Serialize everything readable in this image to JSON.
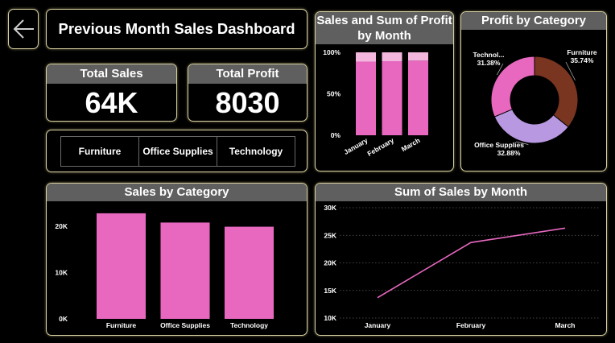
{
  "header": {
    "title": "Previous Month Sales Dashboard"
  },
  "kpis": {
    "total_sales_label": "Total Sales",
    "total_sales_value": "64K",
    "total_profit_label": "Total Profit",
    "total_profit_value": "8030"
  },
  "slicer": {
    "items": [
      "Furniture",
      "Office Supplies",
      "Technology"
    ]
  },
  "colors": {
    "accent_pink": "#e868c0",
    "light_pink": "#f3b6dc",
    "furniture_brown": "#7a3520",
    "office_lavender": "#b898e0",
    "header_gray": "#5f5f5f",
    "border_gold": "#d8d0a0"
  },
  "chart_data": [
    {
      "id": "stacked",
      "type": "bar",
      "stacked_percent": true,
      "title": "Sales and Sum of Profit by Month",
      "categories": [
        "January",
        "February",
        "March"
      ],
      "series": [
        {
          "values": [
            88.8,
            89.3,
            90.0
          ],
          "color": "#e868c0"
        },
        {
          "values": [
            11.2,
            10.7,
            10.0
          ],
          "color": "#f3b6dc"
        }
      ],
      "y_ticks": [
        "0%",
        "50%",
        "100%"
      ],
      "ylim": [
        0,
        100
      ]
    },
    {
      "id": "donut",
      "type": "pie",
      "title": "Profit by Category",
      "slices": [
        {
          "label": "Furniture",
          "value_label": "35.74%",
          "value": 35.74,
          "color": "#7a3520"
        },
        {
          "label": "Office Supplies",
          "value_label": "32.88%",
          "value": 32.88,
          "color": "#b898e0"
        },
        {
          "label": "Technol...",
          "value_label": "31.38%",
          "value": 31.38,
          "color": "#e868c0"
        }
      ]
    },
    {
      "id": "bar",
      "type": "bar",
      "title": "Sales by Category",
      "categories": [
        "Furniture",
        "Office Supplies",
        "Technology"
      ],
      "values": [
        22800,
        20800,
        19900
      ],
      "y_ticks": [
        {
          "value": 0,
          "label": "0K"
        },
        {
          "value": 10000,
          "label": "10K"
        },
        {
          "value": 20000,
          "label": "20K"
        }
      ],
      "ylim": [
        0,
        24000
      ],
      "color": "#e868c0"
    },
    {
      "id": "line",
      "type": "line",
      "title": "Sum of Sales by Month",
      "categories": [
        "January",
        "February",
        "March"
      ],
      "values": [
        13700,
        23700,
        26300
      ],
      "y_ticks": [
        {
          "value": 10000,
          "label": "10K"
        },
        {
          "value": 15000,
          "label": "15K"
        },
        {
          "value": 20000,
          "label": "20K"
        },
        {
          "value": 25000,
          "label": "25K"
        },
        {
          "value": 30000,
          "label": "30K"
        }
      ],
      "ylim": [
        10000,
        30000
      ],
      "color": "#e868c0"
    }
  ]
}
